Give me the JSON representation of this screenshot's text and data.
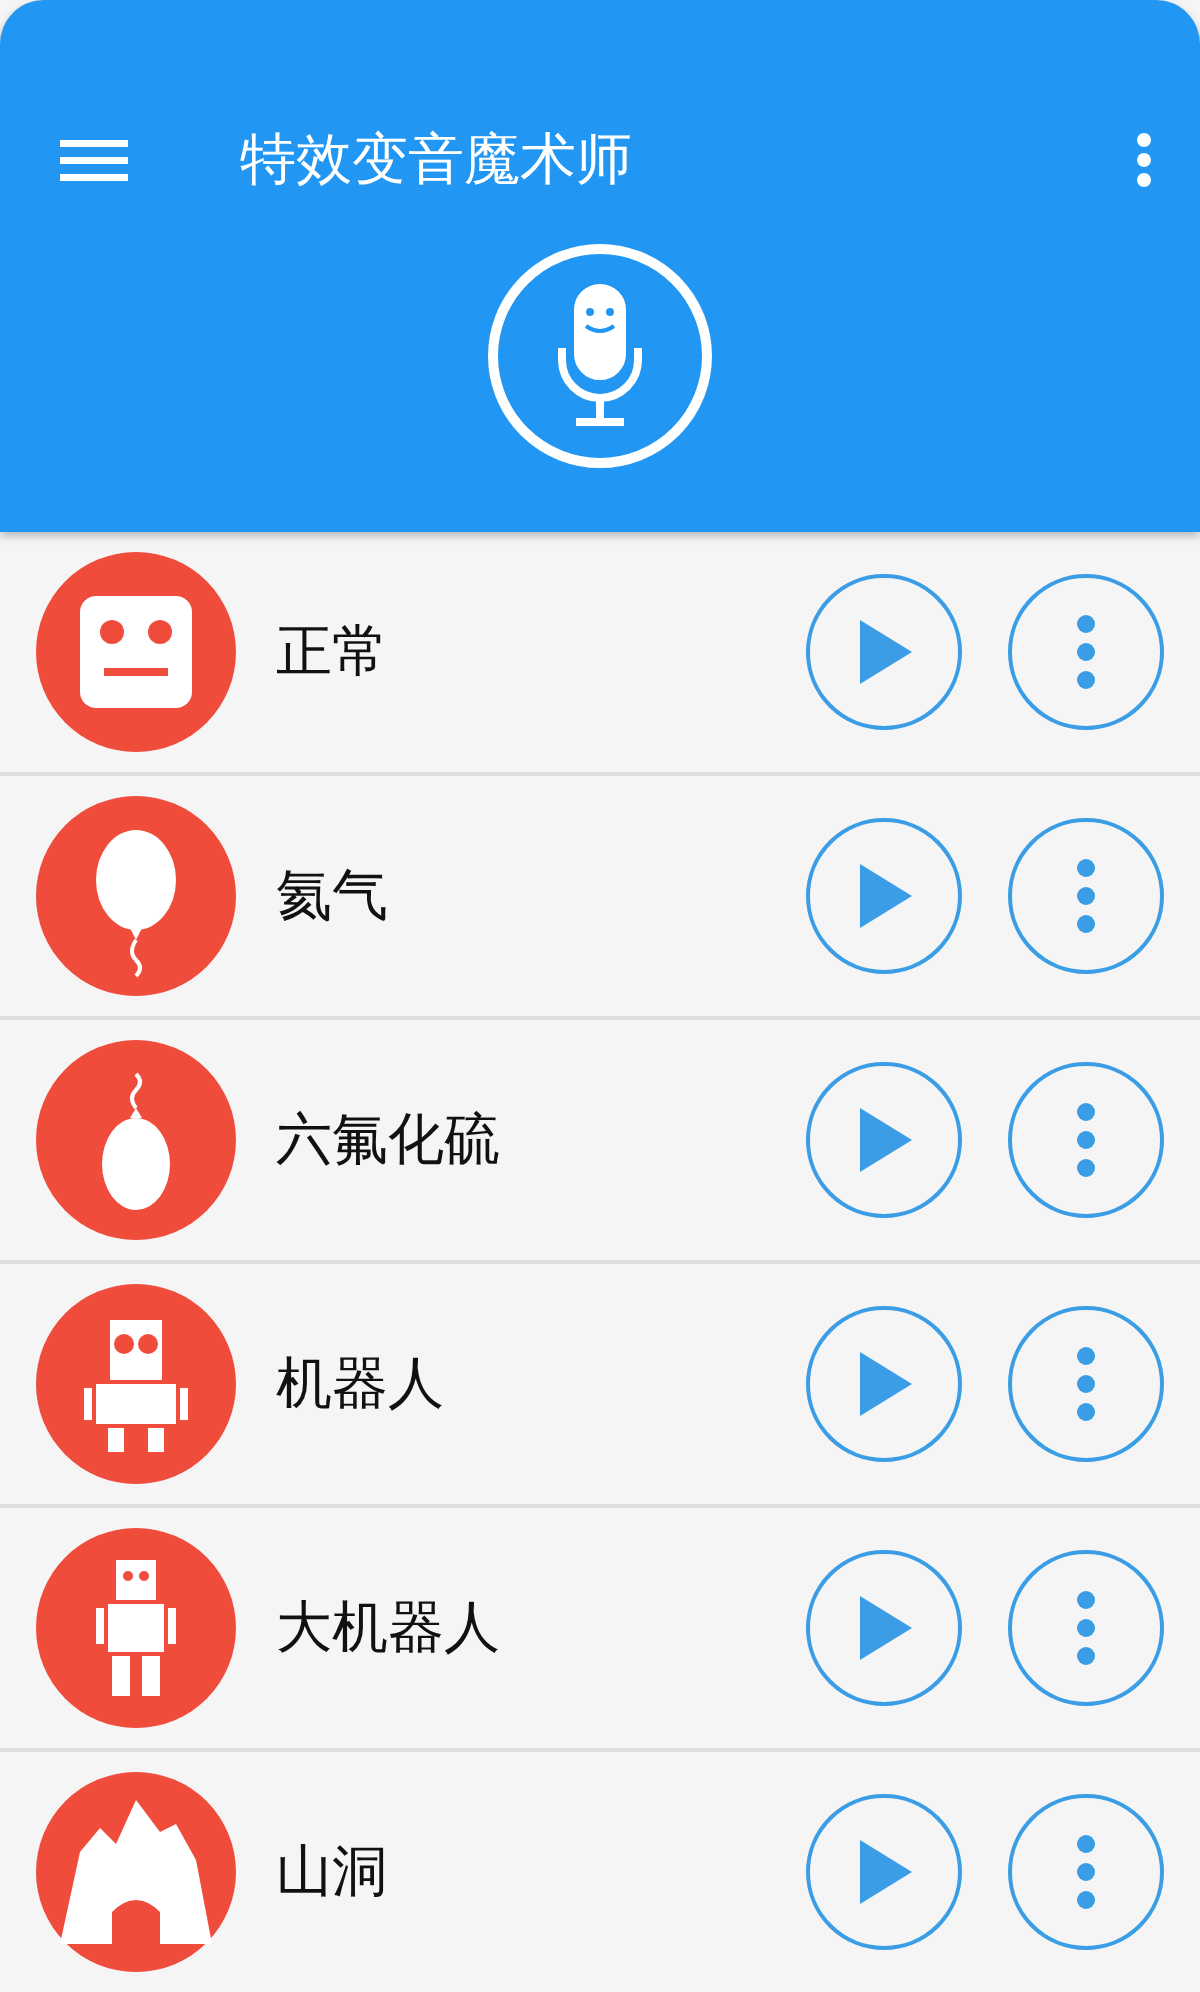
{
  "app_bar": {
    "title": "特效变音魔术师"
  },
  "effects": [
    {
      "name": "正常",
      "kind": "face"
    },
    {
      "name": "氦气",
      "kind": "balloon"
    },
    {
      "name": "六氟化硫",
      "kind": "heavy-balloon"
    },
    {
      "name": "机器人",
      "kind": "robot"
    },
    {
      "name": "大机器人",
      "kind": "tall-robot"
    },
    {
      "name": "山洞",
      "kind": "cave"
    }
  ]
}
